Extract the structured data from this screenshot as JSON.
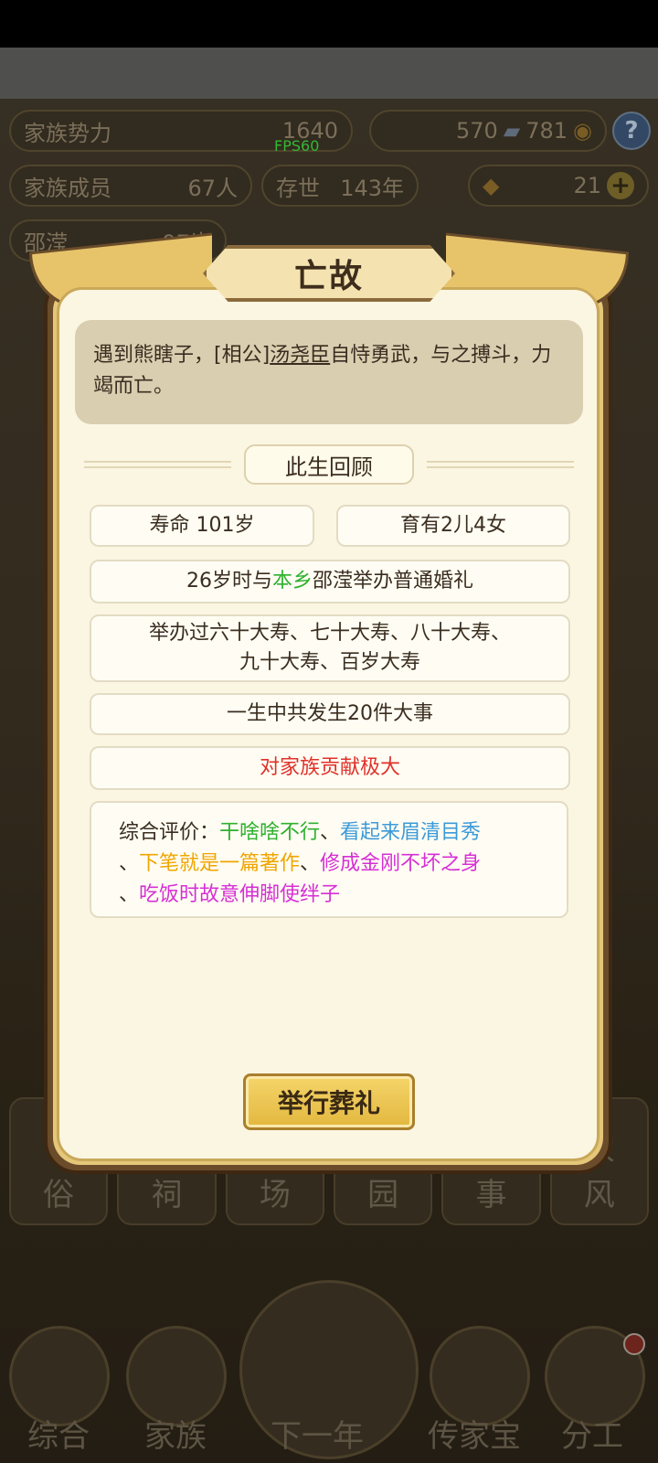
{
  "hud": {
    "clan_power_label": "家族势力",
    "clan_power_value": "1640",
    "fps": "FPS60",
    "resource_a": "570",
    "resource_b": "781",
    "members_label": "家族成员",
    "members_value": "67人",
    "existence_label": "存世",
    "existence_value": "143年",
    "gold_value": "21",
    "help": "?"
  },
  "background": {
    "person_name": "邵滢",
    "person_age": "97岁",
    "bg_tiles": [
      "俗",
      "祠",
      "场",
      "园",
      "事",
      "风"
    ],
    "bg_tile_top_right": "家",
    "nav": [
      "综合",
      "家族",
      "下一年",
      "传家宝",
      "分工"
    ]
  },
  "modal": {
    "title": "亡故",
    "event_prefix": "遇到熊瞎子，[相公]",
    "event_name": "汤尧臣",
    "event_suffix": "自恃勇武，与之搏斗，力竭而亡。",
    "section_title": "此生回顾",
    "lifespan": "寿命 101岁",
    "children": "育有2儿4女",
    "marriage_prefix": "26岁时与",
    "marriage_origin": "本乡",
    "marriage_suffix": "邵滢举办普通婚礼",
    "birthdays_line1": "举办过六十大寿、七十大寿、八十大寿、",
    "birthdays_line2": "九十大寿、百岁大寿",
    "events": "一生中共发生20件大事",
    "contribution": "对家族贡献极大",
    "eval_label": "综合评价：",
    "eval_traits": [
      {
        "text": "干啥啥不行",
        "color": "#2fb02f"
      },
      {
        "text": "看起来眉清目秀",
        "color": "#3c9ad9"
      },
      {
        "text": "下笔就是一篇著作",
        "color": "#f0a500"
      },
      {
        "text": "修成金刚不坏之身",
        "color": "#d62fd6"
      },
      {
        "text": "吃饭时故意伸脚使绊子",
        "color": "#d62fd6"
      }
    ],
    "sep": "、",
    "button": "举行葬礼"
  }
}
